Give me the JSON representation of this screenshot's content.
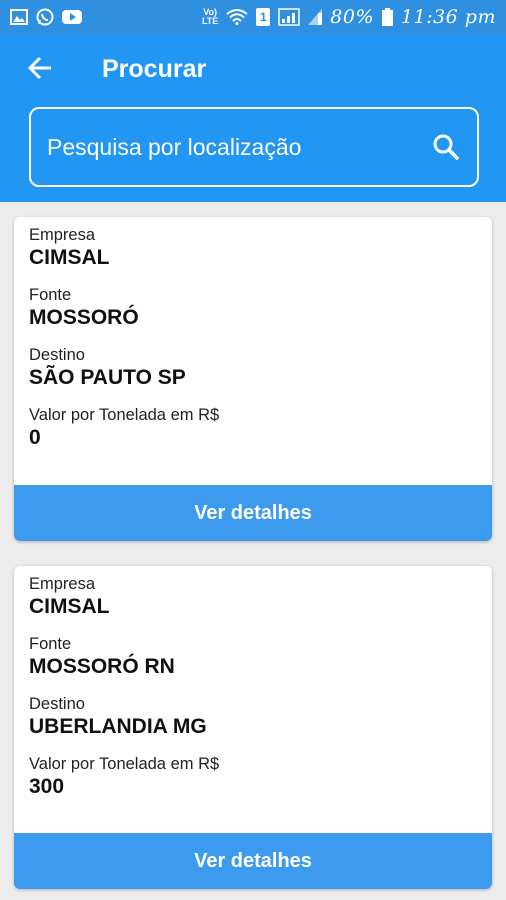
{
  "status_bar": {
    "volte": "Vo)\nLTE",
    "sim_badge": "1",
    "battery": "80%",
    "time": "11:36 pm",
    "icons": [
      "image-icon",
      "whatsapp-icon",
      "youtube-icon",
      "volte-icon",
      "wifi-icon",
      "sim-icon",
      "signal-icon",
      "signal-icon",
      "battery-icon"
    ]
  },
  "header": {
    "back_icon": "arrow-left-icon",
    "title": "Procurar"
  },
  "search": {
    "placeholder": "Pesquisa por localização",
    "value": "",
    "icon": "search-icon"
  },
  "results": [
    {
      "empresa_label": "Empresa",
      "empresa": "CIMSAL",
      "fonte_label": "Fonte",
      "fonte": "MOSSORÓ",
      "destino_label": "Destino",
      "destino": "SÃO PAUTO SP",
      "valor_label": "Valor por Tonelada em R$",
      "valor": "0",
      "button_label": "Ver detalhes"
    },
    {
      "empresa_label": "Empresa",
      "empresa": "CIMSAL",
      "fonte_label": "Fonte",
      "fonte": "MOSSORÓ RN",
      "destino_label": "Destino",
      "destino": "UBERLANDIA MG",
      "valor_label": "Valor por Tonelada em R$",
      "valor": "300",
      "button_label": "Ver detalhes"
    }
  ],
  "colors": {
    "status_bar": "#2f8fe0",
    "app_bar": "#2196f3",
    "button": "#3c9bee",
    "background": "#ececec"
  }
}
